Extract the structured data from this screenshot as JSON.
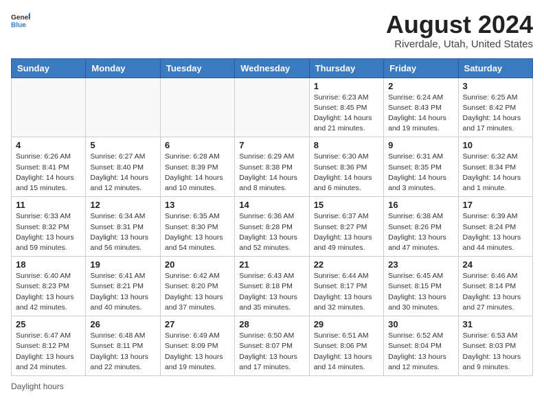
{
  "header": {
    "logo_general": "General",
    "logo_blue": "Blue",
    "month_year": "August 2024",
    "location": "Riverdale, Utah, United States"
  },
  "weekdays": [
    "Sunday",
    "Monday",
    "Tuesday",
    "Wednesday",
    "Thursday",
    "Friday",
    "Saturday"
  ],
  "weeks": [
    [
      {
        "day": "",
        "info": ""
      },
      {
        "day": "",
        "info": ""
      },
      {
        "day": "",
        "info": ""
      },
      {
        "day": "",
        "info": ""
      },
      {
        "day": "1",
        "info": "Sunrise: 6:23 AM\nSunset: 8:45 PM\nDaylight: 14 hours and 21 minutes."
      },
      {
        "day": "2",
        "info": "Sunrise: 6:24 AM\nSunset: 8:43 PM\nDaylight: 14 hours and 19 minutes."
      },
      {
        "day": "3",
        "info": "Sunrise: 6:25 AM\nSunset: 8:42 PM\nDaylight: 14 hours and 17 minutes."
      }
    ],
    [
      {
        "day": "4",
        "info": "Sunrise: 6:26 AM\nSunset: 8:41 PM\nDaylight: 14 hours and 15 minutes."
      },
      {
        "day": "5",
        "info": "Sunrise: 6:27 AM\nSunset: 8:40 PM\nDaylight: 14 hours and 12 minutes."
      },
      {
        "day": "6",
        "info": "Sunrise: 6:28 AM\nSunset: 8:39 PM\nDaylight: 14 hours and 10 minutes."
      },
      {
        "day": "7",
        "info": "Sunrise: 6:29 AM\nSunset: 8:38 PM\nDaylight: 14 hours and 8 minutes."
      },
      {
        "day": "8",
        "info": "Sunrise: 6:30 AM\nSunset: 8:36 PM\nDaylight: 14 hours and 6 minutes."
      },
      {
        "day": "9",
        "info": "Sunrise: 6:31 AM\nSunset: 8:35 PM\nDaylight: 14 hours and 3 minutes."
      },
      {
        "day": "10",
        "info": "Sunrise: 6:32 AM\nSunset: 8:34 PM\nDaylight: 14 hours and 1 minute."
      }
    ],
    [
      {
        "day": "11",
        "info": "Sunrise: 6:33 AM\nSunset: 8:32 PM\nDaylight: 13 hours and 59 minutes."
      },
      {
        "day": "12",
        "info": "Sunrise: 6:34 AM\nSunset: 8:31 PM\nDaylight: 13 hours and 56 minutes."
      },
      {
        "day": "13",
        "info": "Sunrise: 6:35 AM\nSunset: 8:30 PM\nDaylight: 13 hours and 54 minutes."
      },
      {
        "day": "14",
        "info": "Sunrise: 6:36 AM\nSunset: 8:28 PM\nDaylight: 13 hours and 52 minutes."
      },
      {
        "day": "15",
        "info": "Sunrise: 6:37 AM\nSunset: 8:27 PM\nDaylight: 13 hours and 49 minutes."
      },
      {
        "day": "16",
        "info": "Sunrise: 6:38 AM\nSunset: 8:26 PM\nDaylight: 13 hours and 47 minutes."
      },
      {
        "day": "17",
        "info": "Sunrise: 6:39 AM\nSunset: 8:24 PM\nDaylight: 13 hours and 44 minutes."
      }
    ],
    [
      {
        "day": "18",
        "info": "Sunrise: 6:40 AM\nSunset: 8:23 PM\nDaylight: 13 hours and 42 minutes."
      },
      {
        "day": "19",
        "info": "Sunrise: 6:41 AM\nSunset: 8:21 PM\nDaylight: 13 hours and 40 minutes."
      },
      {
        "day": "20",
        "info": "Sunrise: 6:42 AM\nSunset: 8:20 PM\nDaylight: 13 hours and 37 minutes."
      },
      {
        "day": "21",
        "info": "Sunrise: 6:43 AM\nSunset: 8:18 PM\nDaylight: 13 hours and 35 minutes."
      },
      {
        "day": "22",
        "info": "Sunrise: 6:44 AM\nSunset: 8:17 PM\nDaylight: 13 hours and 32 minutes."
      },
      {
        "day": "23",
        "info": "Sunrise: 6:45 AM\nSunset: 8:15 PM\nDaylight: 13 hours and 30 minutes."
      },
      {
        "day": "24",
        "info": "Sunrise: 6:46 AM\nSunset: 8:14 PM\nDaylight: 13 hours and 27 minutes."
      }
    ],
    [
      {
        "day": "25",
        "info": "Sunrise: 6:47 AM\nSunset: 8:12 PM\nDaylight: 13 hours and 24 minutes."
      },
      {
        "day": "26",
        "info": "Sunrise: 6:48 AM\nSunset: 8:11 PM\nDaylight: 13 hours and 22 minutes."
      },
      {
        "day": "27",
        "info": "Sunrise: 6:49 AM\nSunset: 8:09 PM\nDaylight: 13 hours and 19 minutes."
      },
      {
        "day": "28",
        "info": "Sunrise: 6:50 AM\nSunset: 8:07 PM\nDaylight: 13 hours and 17 minutes."
      },
      {
        "day": "29",
        "info": "Sunrise: 6:51 AM\nSunset: 8:06 PM\nDaylight: 13 hours and 14 minutes."
      },
      {
        "day": "30",
        "info": "Sunrise: 6:52 AM\nSunset: 8:04 PM\nDaylight: 13 hours and 12 minutes."
      },
      {
        "day": "31",
        "info": "Sunrise: 6:53 AM\nSunset: 8:03 PM\nDaylight: 13 hours and 9 minutes."
      }
    ]
  ],
  "footer": "Daylight hours"
}
